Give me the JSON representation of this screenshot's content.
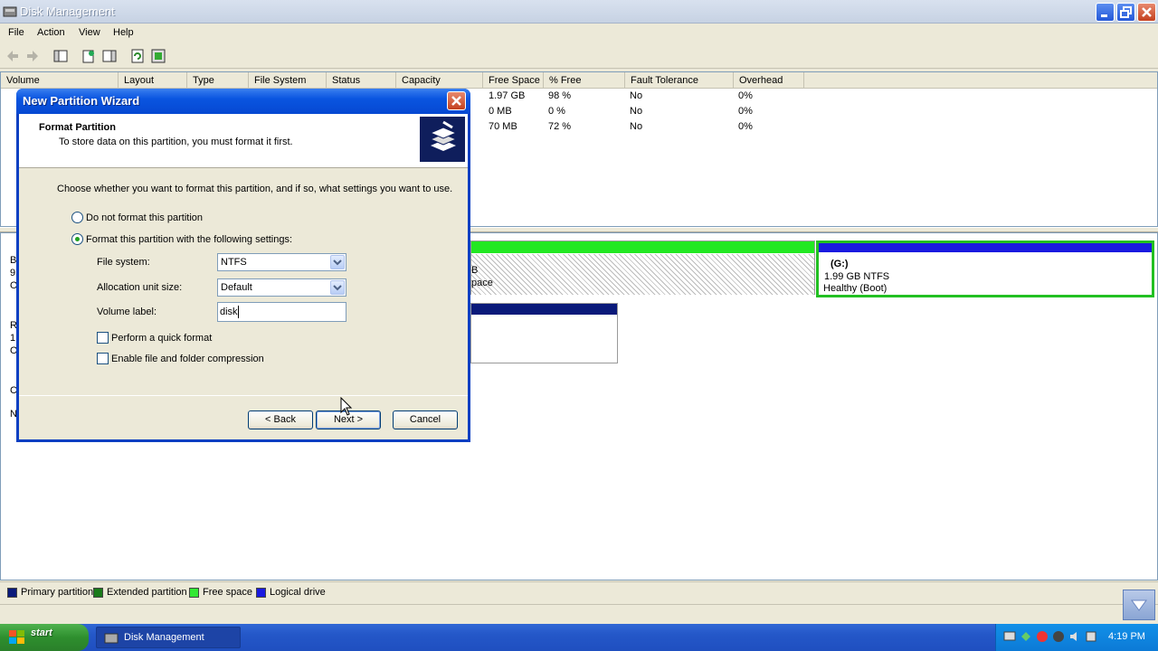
{
  "window": {
    "title": "Disk Management"
  },
  "menu": [
    "File",
    "Action",
    "View",
    "Help"
  ],
  "volume_list": {
    "columns": [
      "Volume",
      "Layout",
      "Type",
      "File System",
      "Status",
      "Capacity",
      "Free Space",
      "% Free",
      "Fault Tolerance",
      "Overhead"
    ],
    "rows": [
      {
        "free": "1.97 GB",
        "pct": "98 %",
        "fault": "No",
        "overhead": "0%"
      },
      {
        "free": "0 MB",
        "pct": "0 %",
        "fault": "No",
        "overhead": "0%"
      },
      {
        "free": "70 MB",
        "pct": "72 %",
        "fault": "No",
        "overhead": "0%"
      }
    ]
  },
  "graphical": {
    "free_partial_1": "B",
    "free_partial_2": "pace",
    "drive_g": {
      "name": "(G:)",
      "size": "1.99 GB NTFS",
      "status": "Healthy (Boot)"
    },
    "left_labels": [
      "B",
      "9",
      "O",
      "R",
      "1",
      "O",
      "C",
      "N"
    ]
  },
  "legend": [
    {
      "label": "Primary partition",
      "color": "#0a1a7a"
    },
    {
      "label": "Extended partition",
      "color": "#1a7a1a"
    },
    {
      "label": "Free space",
      "color": "#33e833"
    },
    {
      "label": "Logical drive",
      "color": "#1a1ae0"
    }
  ],
  "dialog": {
    "title": "New Partition Wizard",
    "header_title": "Format Partition",
    "header_sub": "To store data on this partition, you must format it first.",
    "instruction": "Choose whether you want to format this partition, and if so, what settings you want to use.",
    "radio_no_format": "Do not format this partition",
    "radio_format": "Format this partition with the following settings:",
    "fs_label": "File system:",
    "fs_value": "NTFS",
    "alloc_label": "Allocation unit size:",
    "alloc_value": "Default",
    "vol_label": "Volume label:",
    "vol_value": "disk",
    "quick_format": "Perform a quick format",
    "compression": "Enable file and folder compression",
    "back": "< Back",
    "next": "Next >",
    "cancel": "Cancel"
  },
  "taskbar": {
    "start": "start",
    "task": "Disk Management",
    "clock": "4:19 PM"
  }
}
